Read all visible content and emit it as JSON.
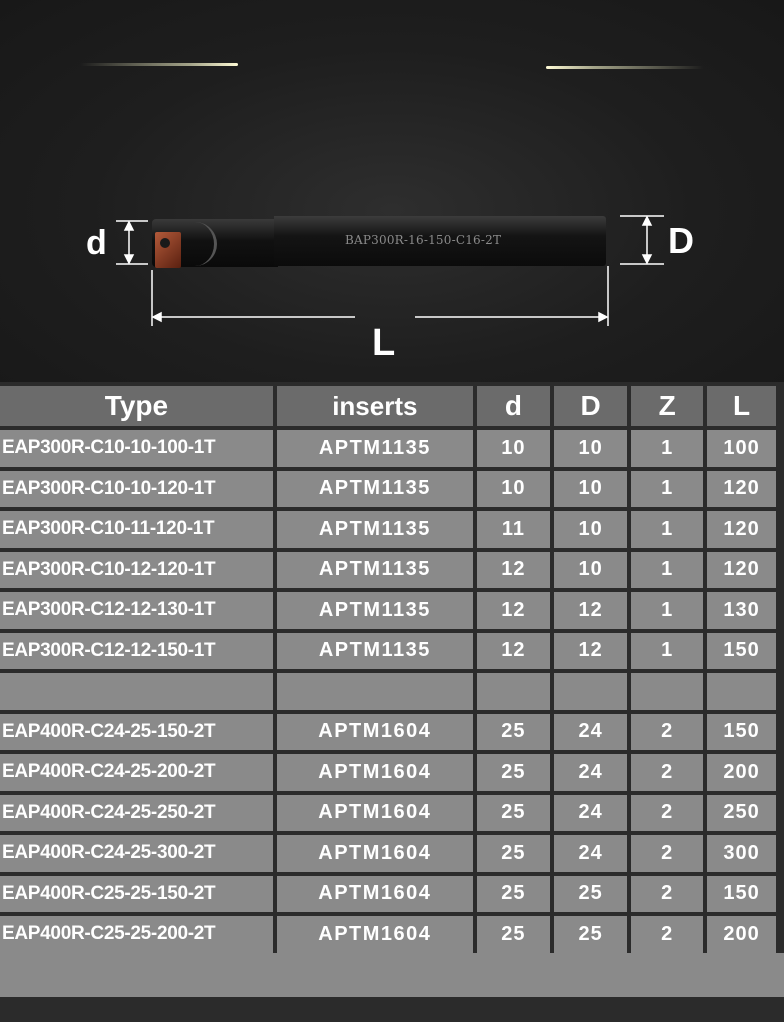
{
  "hero": {
    "engraving": "BAP300R-16-150-C16-2T",
    "dim_d": "d",
    "dim_D": "D",
    "dim_L": "L"
  },
  "table": {
    "headers": [
      "Type",
      "inserts",
      "d",
      "D",
      "Z",
      "L"
    ],
    "rows": [
      [
        "EAP300R-C10-10-100-1T",
        "APTM1135",
        "10",
        "10",
        "1",
        "100"
      ],
      [
        "EAP300R-C10-10-120-1T",
        "APTM1135",
        "10",
        "10",
        "1",
        "120"
      ],
      [
        "EAP300R-C10-11-120-1T",
        "APTM1135",
        "11",
        "10",
        "1",
        "120"
      ],
      [
        "EAP300R-C10-12-120-1T",
        "APTM1135",
        "12",
        "10",
        "1",
        "120"
      ],
      [
        "EAP300R-C12-12-130-1T",
        "APTM1135",
        "12",
        "12",
        "1",
        "130"
      ],
      [
        "EAP300R-C12-12-150-1T",
        "APTM1135",
        "12",
        "12",
        "1",
        "150"
      ],
      [
        "",
        "",
        "",
        "",
        "",
        ""
      ],
      [
        "EAP400R-C24-25-150-2T",
        "APTM1604",
        "25",
        "24",
        "2",
        "150"
      ],
      [
        "EAP400R-C24-25-200-2T",
        "APTM1604",
        "25",
        "24",
        "2",
        "200"
      ],
      [
        "EAP400R-C24-25-250-2T",
        "APTM1604",
        "25",
        "24",
        "2",
        "250"
      ],
      [
        "EAP400R-C24-25-300-2T",
        "APTM1604",
        "25",
        "24",
        "2",
        "300"
      ],
      [
        "EAP400R-C25-25-150-2T",
        "APTM1604",
        "25",
        "25",
        "2",
        "150"
      ],
      [
        "EAP400R-C25-25-200-2T",
        "APTM1604",
        "25",
        "25",
        "2",
        "200"
      ]
    ]
  }
}
